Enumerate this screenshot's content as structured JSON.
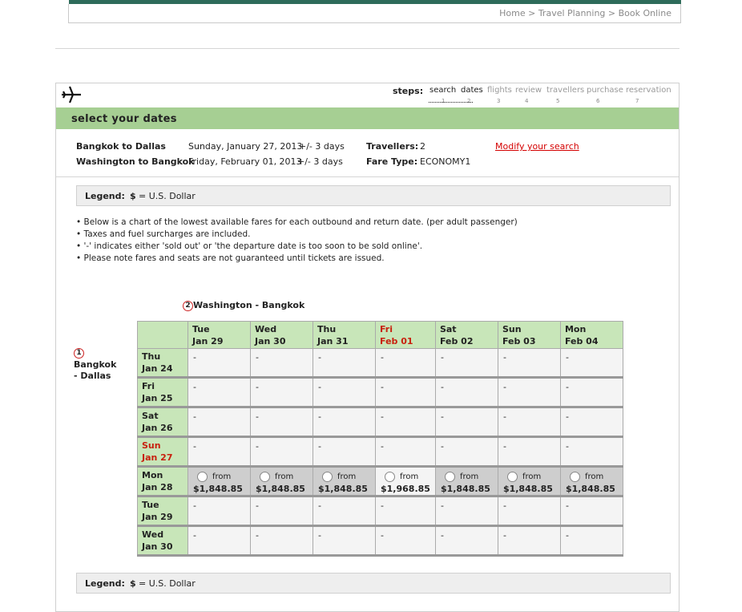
{
  "breadcrumb": {
    "home": "Home",
    "sep": ">",
    "planning": "Travel Planning",
    "book": "Book Online"
  },
  "steps": {
    "label": "steps:",
    "items": [
      {
        "label": "search",
        "num": "1",
        "active": true
      },
      {
        "label": "dates",
        "num": "2",
        "active": true
      },
      {
        "label": "flights",
        "num": "3",
        "active": false
      },
      {
        "label": "review",
        "num": "4",
        "active": false
      },
      {
        "label": "travellers",
        "num": "5",
        "active": false
      },
      {
        "label": "purchase",
        "num": "6",
        "active": false
      },
      {
        "label": "reservation",
        "num": "7",
        "active": false
      }
    ]
  },
  "page_title": "select your dates",
  "trip": {
    "outbound_route": "Bangkok to Dallas",
    "outbound_date": "Sunday, January 27, 2013",
    "outbound_flex": "+/- 3 days",
    "return_route": "Washington to Bangkok",
    "return_date": "Friday, February 01, 2013",
    "return_flex": "+/- 3 days",
    "travellers_label": "Travellers:",
    "travellers_value": "2",
    "fare_label": "Fare Type:",
    "fare_value": "ECONOMY1",
    "modify_link": "Modify your search"
  },
  "legend": {
    "label": "Legend:",
    "symbol": "$",
    "text": "= U.S. Dollar"
  },
  "notes": [
    "• Below is a chart of the lowest available fares for each outbound and return date. (per adult passenger)",
    "• Taxes and fuel surcharges are included.",
    "• '-' indicates either 'sold out' or 'the departure date is too soon to be sold online'.",
    "• Please note fares and seats are not guaranteed until tickets are issued."
  ],
  "return_leg": {
    "num": "2",
    "title": "Washington - Bangkok"
  },
  "outbound_leg": {
    "num": "1",
    "title": "Bangkok - Dallas"
  },
  "columns": [
    {
      "day": "Tue",
      "date": "Jan 29"
    },
    {
      "day": "Wed",
      "date": "Jan 30"
    },
    {
      "day": "Thu",
      "date": "Jan 31"
    },
    {
      "day": "Fri",
      "date": "Feb 01",
      "highlight": true
    },
    {
      "day": "Sat",
      "date": "Feb 02"
    },
    {
      "day": "Sun",
      "date": "Feb 03"
    },
    {
      "day": "Mon",
      "date": "Feb 04"
    }
  ],
  "rows": [
    {
      "day": "Thu",
      "date": "Jan 24",
      "cells": [
        "-",
        "-",
        "-",
        "-",
        "-",
        "-",
        "-"
      ]
    },
    {
      "day": "Fri",
      "date": "Jan 25",
      "cells": [
        "-",
        "-",
        "-",
        "-",
        "-",
        "-",
        "-"
      ]
    },
    {
      "day": "Sat",
      "date": "Jan 26",
      "cells": [
        "-",
        "-",
        "-",
        "-",
        "-",
        "-",
        "-"
      ]
    },
    {
      "day": "Sun",
      "date": "Jan 27",
      "highlight": true,
      "cells": [
        "-",
        "-",
        "-",
        "-",
        "-",
        "-",
        "-"
      ]
    },
    {
      "day": "Mon",
      "date": "Jan 28",
      "available": true,
      "from": "from",
      "cells": [
        "$1,848.85",
        "$1,848.85",
        "$1,848.85",
        "$1,968.85",
        "$1,848.85",
        "$1,848.85",
        "$1,848.85"
      ]
    },
    {
      "day": "Tue",
      "date": "Jan 29",
      "cells": [
        "-",
        "-",
        "-",
        "-",
        "-",
        "-",
        "-"
      ]
    },
    {
      "day": "Wed",
      "date": "Jan 30",
      "cells": [
        "-",
        "-",
        "-",
        "-",
        "-",
        "-",
        "-"
      ]
    }
  ],
  "colors": {
    "brand": "#2e6b5a",
    "header_green": "#a6cf93",
    "cell_green": "#c8e6b9",
    "accent_red": "#c8210f",
    "link_red": "#d40000"
  },
  "icons": {
    "plane": "airplane-icon",
    "radio": "radio-button"
  }
}
